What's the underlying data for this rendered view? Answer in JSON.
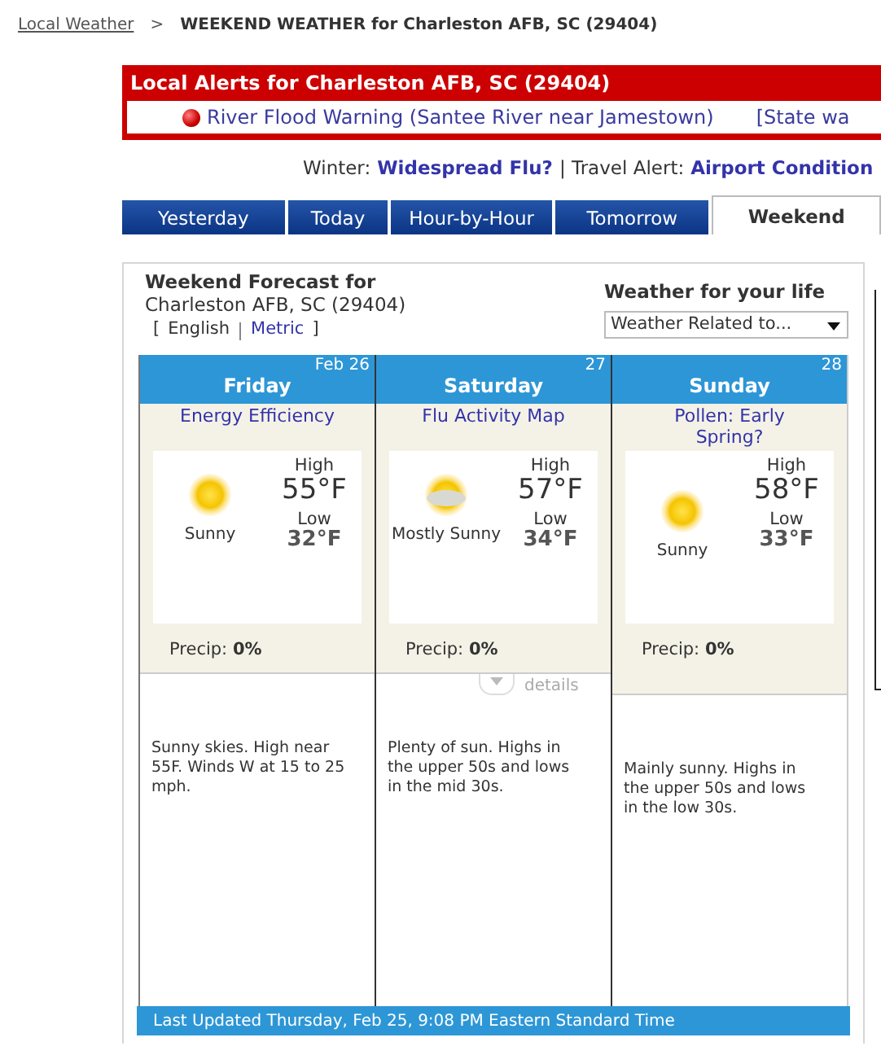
{
  "breadcrumb": {
    "link": "Local Weather",
    "separator": ">",
    "title": "WEEKEND WEATHER for Charleston AFB, SC (29404)"
  },
  "alerts": {
    "title": "Local Alerts for Charleston AFB, SC (29404)",
    "items": [
      {
        "kind": "warning",
        "text": "River Flood Warning (Santee River near Jamestown)"
      },
      {
        "kind": "link",
        "text": "[State wa"
      }
    ]
  },
  "promo": [
    {
      "kind": "label",
      "text": "Winter:"
    },
    {
      "kind": "link",
      "text": "Widespread Flu?"
    },
    {
      "kind": "label",
      "text": "| Travel Alert:"
    },
    {
      "kind": "link",
      "text": "Airport Condition"
    }
  ],
  "tabs": [
    {
      "label": "Yesterday",
      "selected": false
    },
    {
      "label": "Today",
      "selected": false
    },
    {
      "label": "Hour-by-Hour",
      "selected": false
    },
    {
      "label": "Tomorrow",
      "selected": false
    },
    {
      "label": "Weekend",
      "selected": true
    }
  ],
  "forecast": {
    "title": "Weekend Forecast for",
    "location": "Charleston AFB, SC (29404)",
    "units_open": "[",
    "units_close": "]",
    "units": [
      {
        "label": "English",
        "selected": true
      },
      {
        "label": "Metric",
        "selected": false
      }
    ],
    "life_title": "Weather for your life",
    "life_select": "Weather Related to...",
    "days": [
      {
        "name": "Friday",
        "date": "Feb 26",
        "link": "Energy Efficiency",
        "kind": "sunny",
        "condition": "Sunny",
        "high_label": "High",
        "high": "55°F",
        "low_label": "Low",
        "low": "32°F",
        "precip_label": "Precip:",
        "precip": "0%",
        "description": "Sunny skies. High near 55F. Winds W at 15 to 25 mph."
      },
      {
        "name": "Saturday",
        "date": "27",
        "link": "Flu Activity Map",
        "kind": "mostly-sunny",
        "condition": "Mostly Sunny",
        "high_label": "High",
        "high": "57°F",
        "low_label": "Low",
        "low": "34°F",
        "precip_label": "Precip:",
        "precip": "0%",
        "details": "details",
        "description": "Plenty of sun. Highs in the upper 50s and lows in the mid 30s."
      },
      {
        "name": "Sunday",
        "date": "28",
        "link": "Pollen: Early Spring?",
        "kind": "sunny",
        "condition": "Sunny",
        "high_label": "High",
        "high": "58°F",
        "low_label": "Low",
        "low": "33°F",
        "precip_label": "Precip:",
        "precip": "0%",
        "description": "Mainly sunny. Highs in the upper 50s and lows in the low 30s."
      }
    ],
    "updated": "Last Updated Thursday, Feb 25, 9:08 PM Eastern Standard Time"
  }
}
